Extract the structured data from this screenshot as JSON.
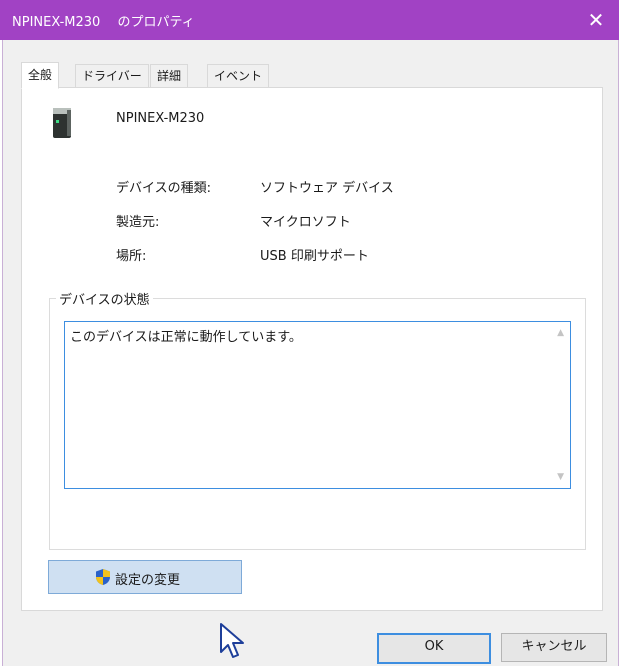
{
  "window": {
    "title": "NPINEX-M230　 のプロパティ",
    "close_glyph": "✕",
    "accent_color": "#a142c4"
  },
  "tabs": [
    {
      "label": "全般",
      "active": true
    },
    {
      "label": "ドライバー",
      "active": false
    },
    {
      "label": "詳細",
      "active": false
    },
    {
      "label": "イベント",
      "active": false
    }
  ],
  "device": {
    "icon": "printer-device-icon",
    "name": "NPINEX-M230",
    "properties": [
      {
        "label": "デバイスの種類:",
        "value": "ソフトウェア デバイス"
      },
      {
        "label": "製造元:",
        "value": "マイクロソフト"
      },
      {
        "label": "場所:",
        "value": "USB 印刷サポート"
      }
    ]
  },
  "status": {
    "group_title": "デバイスの状態",
    "text": "このデバイスは正常に動作しています。"
  },
  "buttons": {
    "change_settings": "設定の変更",
    "change_settings_icon": "uac-shield-icon",
    "ok": "OK",
    "cancel": "キャンセル"
  }
}
